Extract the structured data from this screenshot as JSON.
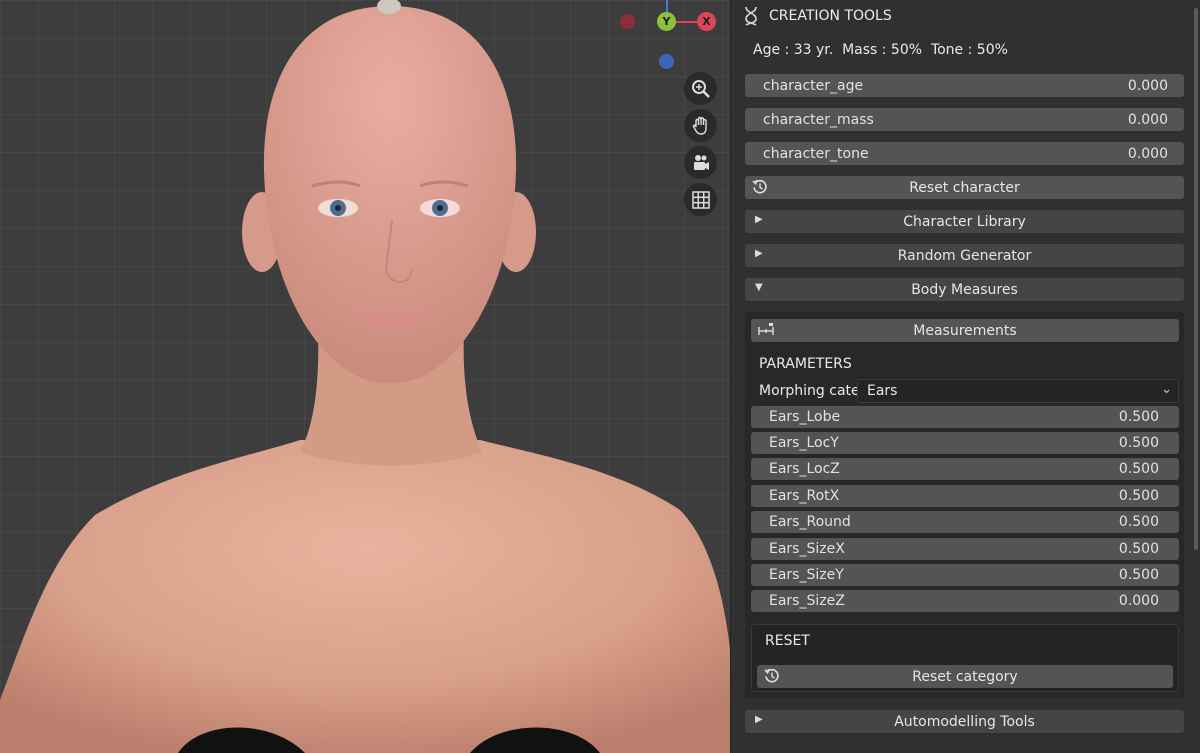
{
  "panel": {
    "title": "CREATION TOOLS",
    "stats": "Age : 33 yr.  Mass : 50%  Tone : 50%",
    "character_fields": [
      {
        "label": "character_age",
        "value": "0.000"
      },
      {
        "label": "character_mass",
        "value": "0.000"
      },
      {
        "label": "character_tone",
        "value": "0.000"
      }
    ],
    "reset_character": "Reset character",
    "sections": {
      "character_library": "Character Library",
      "random_generator": "Random Generator",
      "body_measures": "Body Measures",
      "automodelling_tools": "Automodelling Tools"
    },
    "body_measures": {
      "measurements_button": "Measurements",
      "parameters_heading": "PARAMETERS",
      "morphing_label": "Morphing cate..",
      "morphing_value": "Ears",
      "params": [
        {
          "label": "Ears_Lobe",
          "value": "0.500"
        },
        {
          "label": "Ears_LocY",
          "value": "0.500"
        },
        {
          "label": "Ears_LocZ",
          "value": "0.500"
        },
        {
          "label": "Ears_RotX",
          "value": "0.500"
        },
        {
          "label": "Ears_Round",
          "value": "0.500"
        },
        {
          "label": "Ears_SizeX",
          "value": "0.500"
        },
        {
          "label": "Ears_SizeY",
          "value": "0.500"
        },
        {
          "label": "Ears_SizeZ",
          "value": "0.000"
        }
      ],
      "reset_heading": "RESET",
      "reset_category": "Reset category"
    }
  },
  "viewport": {
    "gizmo": {
      "y_label": "Y",
      "x_label": "X",
      "x_color": "#e0465a",
      "y_color": "#8bc13b",
      "z_color": "#3d7bd6"
    },
    "nav_icons": [
      "zoom-icon",
      "hand-pan-icon",
      "camera-icon",
      "grid-icon"
    ]
  }
}
